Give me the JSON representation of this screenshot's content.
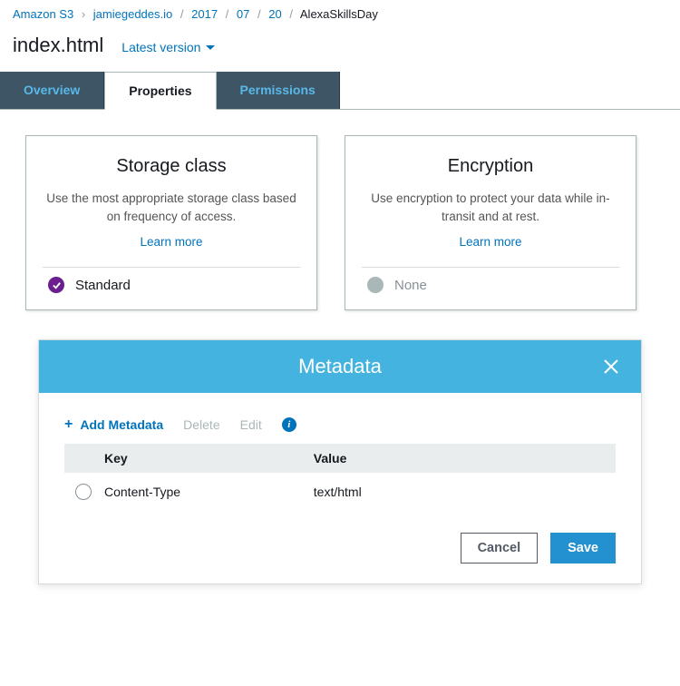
{
  "breadcrumb": {
    "items": [
      {
        "label": "Amazon S3"
      },
      {
        "label": "jamiegeddes.io"
      },
      {
        "label": "2017"
      },
      {
        "label": "07"
      },
      {
        "label": "20"
      },
      {
        "label": "AlexaSkillsDay"
      }
    ]
  },
  "file": {
    "name": "index.html",
    "version_label": "Latest version"
  },
  "tabs": {
    "overview": "Overview",
    "properties": "Properties",
    "permissions": "Permissions"
  },
  "cards": {
    "storage": {
      "title": "Storage class",
      "desc": "Use the most appropriate storage class based on frequency of access.",
      "learn_more": "Learn more",
      "value": "Standard"
    },
    "encryption": {
      "title": "Encryption",
      "desc": "Use encryption to protect your data while in-transit and at rest.",
      "learn_more": "Learn more",
      "value": "None"
    }
  },
  "metadata": {
    "title": "Metadata",
    "toolbar": {
      "add": "Add Metadata",
      "delete": "Delete",
      "edit": "Edit"
    },
    "columns": {
      "key": "Key",
      "value": "Value"
    },
    "rows": [
      {
        "key": "Content-Type",
        "value": "text/html"
      }
    ],
    "actions": {
      "cancel": "Cancel",
      "save": "Save"
    }
  }
}
